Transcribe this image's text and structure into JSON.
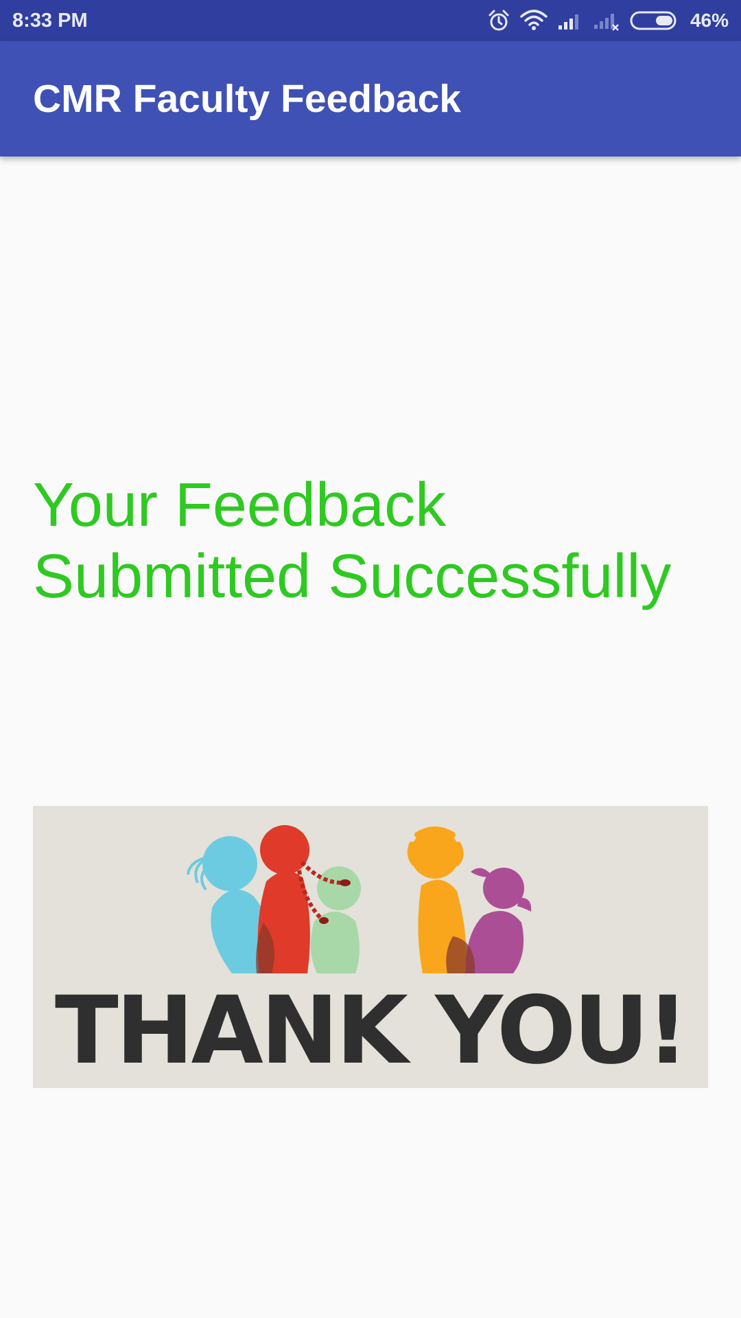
{
  "status_bar": {
    "time": "8:33 PM",
    "battery_percent": "46%",
    "icons": [
      "alarm-icon",
      "wifi-icon",
      "signal-icon",
      "signal-no-sim-icon",
      "battery-icon"
    ]
  },
  "app_bar": {
    "title": "CMR Faculty Feedback",
    "color": "#3f51b5",
    "status_color": "#303f9f"
  },
  "main": {
    "message_line1": "Your Feedback",
    "message_line2": "Submitted Successfully",
    "message_color": "#2ec921",
    "image": {
      "caption": "THANK YOU!",
      "figures": [
        "blue-figure",
        "red-figure",
        "green-figure",
        "orange-figure",
        "purple-figure"
      ]
    }
  }
}
